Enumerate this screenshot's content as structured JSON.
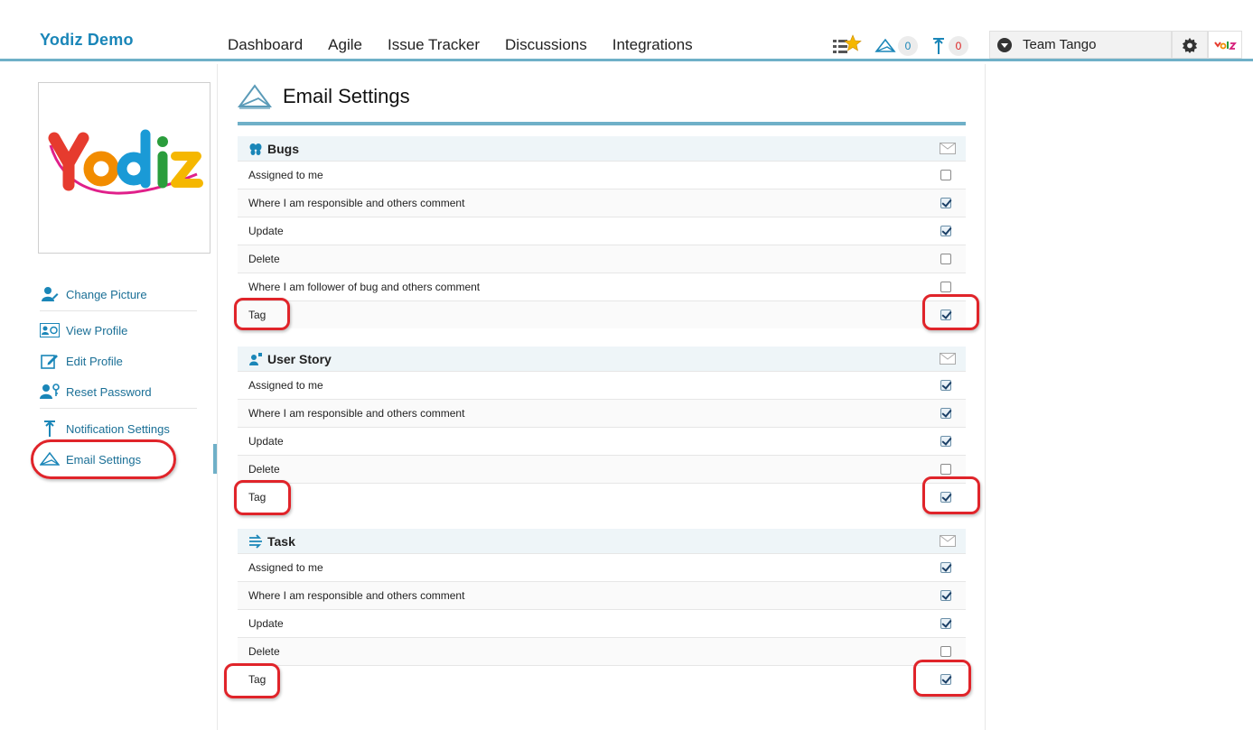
{
  "app": {
    "brand": "Yodiz Demo"
  },
  "nav": {
    "items": [
      "Dashboard",
      "Agile",
      "Issue Tracker",
      "Discussions",
      "Integrations"
    ]
  },
  "header": {
    "email_count": "0",
    "notification_count": "0",
    "team": "Team Tango"
  },
  "sidebar": {
    "items": [
      {
        "label": "Change Picture",
        "icon": "change-picture-icon"
      },
      {
        "label": "View Profile",
        "icon": "view-profile-icon"
      },
      {
        "label": "Edit Profile",
        "icon": "edit-profile-icon"
      },
      {
        "label": "Reset Password",
        "icon": "reset-password-icon"
      },
      {
        "label": "Notification Settings",
        "icon": "notification-icon"
      },
      {
        "label": "Email Settings",
        "icon": "email-settings-icon"
      }
    ]
  },
  "page": {
    "title": "Email Settings"
  },
  "sections": [
    {
      "title": "Bugs",
      "rows": [
        {
          "label": "Assigned to me",
          "checked": false
        },
        {
          "label": "Where I am responsible and others comment",
          "checked": true
        },
        {
          "label": "Update",
          "checked": true
        },
        {
          "label": "Delete",
          "checked": false
        },
        {
          "label": "Where I am follower of bug and others comment",
          "checked": false
        },
        {
          "label": "Tag",
          "checked": true
        }
      ]
    },
    {
      "title": "User Story",
      "rows": [
        {
          "label": "Assigned to me",
          "checked": true
        },
        {
          "label": "Where I am responsible and others comment",
          "checked": true
        },
        {
          "label": "Update",
          "checked": true
        },
        {
          "label": "Delete",
          "checked": false
        },
        {
          "label": "Tag",
          "checked": true
        }
      ]
    },
    {
      "title": "Task",
      "rows": [
        {
          "label": "Assigned to me",
          "checked": true
        },
        {
          "label": "Where I am responsible and others comment",
          "checked": true
        },
        {
          "label": "Update",
          "checked": true
        },
        {
          "label": "Delete",
          "checked": false
        },
        {
          "label": "Tag",
          "checked": true
        }
      ]
    }
  ],
  "colors": {
    "accent": "#1a86b8",
    "rule": "#6fb0c8",
    "annotation": "#e0242a"
  }
}
